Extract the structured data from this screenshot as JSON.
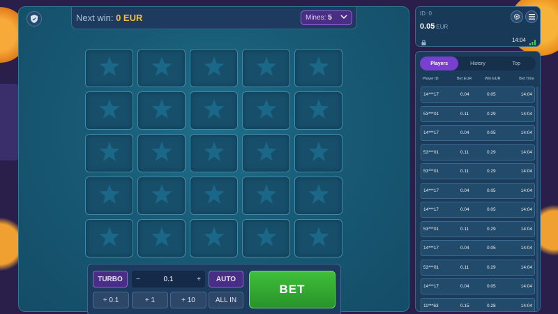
{
  "header": {
    "next_win_label": "Next win:",
    "next_win_value": "0 EUR",
    "mines_label": "Mines:",
    "mines_value": "5"
  },
  "grid": {
    "rows": 5,
    "cols": 5,
    "tile_icon": "star-icon"
  },
  "controls": {
    "turbo": "TURBO",
    "minus": "−",
    "bet_value": "0.1",
    "plus": "+",
    "auto": "AUTO",
    "bet": "BET",
    "quick": [
      "+ 0.1",
      "+ 1",
      "+ 10",
      "ALL IN"
    ]
  },
  "account": {
    "id": "ID :0",
    "balance": "0.05",
    "currency": "EUR",
    "time": "14:04"
  },
  "players": {
    "tabs": [
      "Players",
      "History",
      "Top"
    ],
    "active_tab": "Players",
    "columns": [
      "Player ID",
      "Bet EUR",
      "Win EUR",
      "Bet Time"
    ],
    "rows": [
      [
        "14***17",
        "0.04",
        "0.05",
        "14:04"
      ],
      [
        "53***01",
        "0.11",
        "0.29",
        "14:04"
      ],
      [
        "14***17",
        "0.04",
        "0.05",
        "14:04"
      ],
      [
        "53***01",
        "0.11",
        "0.29",
        "14:04"
      ],
      [
        "53***01",
        "0.11",
        "0.29",
        "14:04"
      ],
      [
        "14***17",
        "0.04",
        "0.05",
        "14:04"
      ],
      [
        "14***17",
        "0.04",
        "0.05",
        "14:04"
      ],
      [
        "53***01",
        "0.11",
        "0.29",
        "14:04"
      ],
      [
        "14***17",
        "0.04",
        "0.05",
        "14:04"
      ],
      [
        "53***01",
        "0.11",
        "0.29",
        "14:04"
      ],
      [
        "14***17",
        "0.04",
        "0.05",
        "14:04"
      ],
      [
        "11***63",
        "0.15",
        "0.28",
        "14:04"
      ]
    ]
  },
  "colors": {
    "accent_purple": "#7a3fd0",
    "bet_green": "#3fbf3a",
    "win_yellow": "#f2c230"
  }
}
